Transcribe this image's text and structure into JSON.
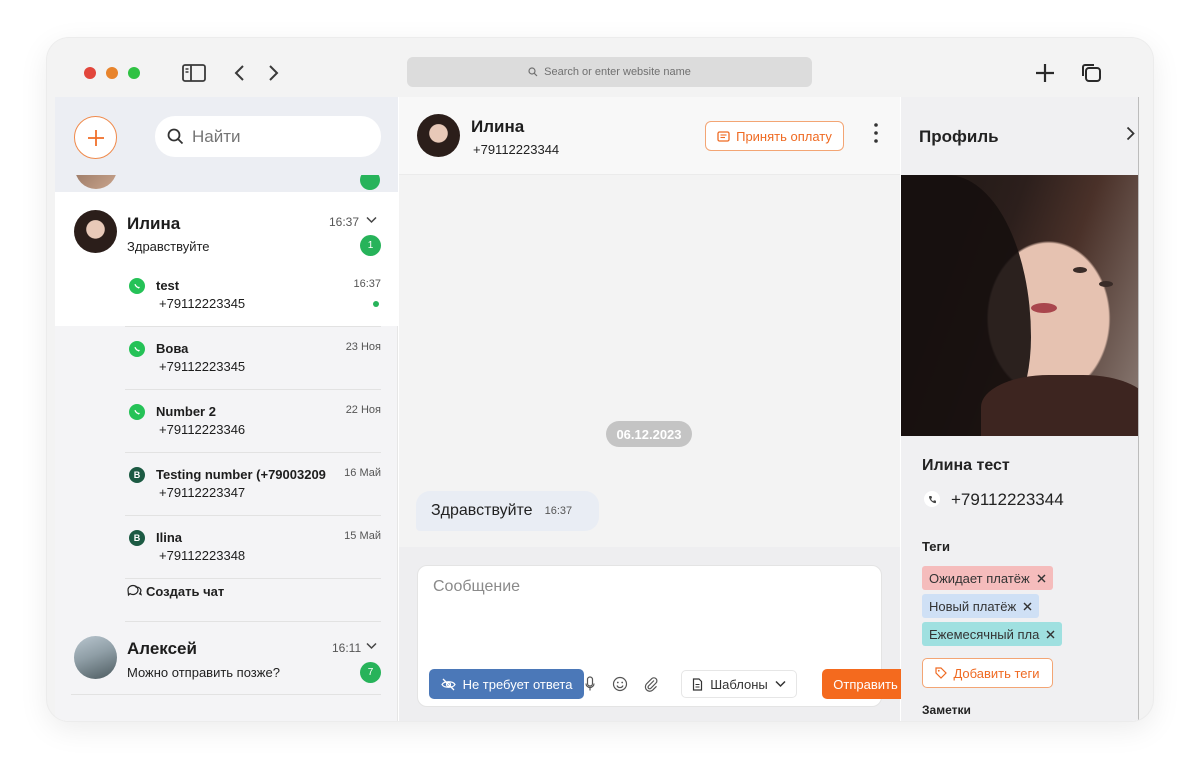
{
  "browser": {
    "address_placeholder": "Search or enter website name"
  },
  "sidebar": {
    "search_placeholder": "Найти",
    "active_conversation": {
      "name": "Илина",
      "last_message": "Здравствуйте",
      "time": "16:37",
      "unread": "1"
    },
    "sub_chats": [
      {
        "channel": "whatsapp",
        "name": "test",
        "phone": "+79112223345",
        "time": "16:37",
        "online": true
      },
      {
        "channel": "whatsapp",
        "name": "Вова",
        "phone": "+79112223345",
        "time": "23 Ноя"
      },
      {
        "channel": "whatsapp",
        "name": "Number 2",
        "phone": "+79112223346",
        "time": "22 Ноя"
      },
      {
        "channel": "viber",
        "name": "Testing number (+79003209",
        "phone": "+79112223347",
        "time": "16 Май"
      },
      {
        "channel": "viber",
        "name": "Ilina",
        "phone": "+79112223348",
        "time": "15 Май"
      }
    ],
    "create_chat_label": "Создать чат",
    "next_conversation": {
      "name": "Алексей",
      "last_message": "Можно отправить позже?",
      "time": "16:11",
      "unread": "7"
    }
  },
  "chat": {
    "contact_name": "Илина",
    "contact_phone": "+79112223344",
    "accept_payment_label": "Принять оплату",
    "date_separator": "06.12.2023",
    "messages": [
      {
        "text": "Здравствуйте",
        "time": "16:37",
        "direction": "incoming"
      }
    ],
    "composer_placeholder": "Сообщение",
    "no_reply_label": "Не требует ответа",
    "templates_label": "Шаблоны",
    "send_label": "Отправить"
  },
  "profile": {
    "title": "Профиль",
    "name": "Илина тест",
    "phone": "+79112223344",
    "tags_label": "Теги",
    "tags": [
      {
        "label": "Ожидает платёж",
        "color": "#f5bcbc"
      },
      {
        "label": "Новый платёж",
        "color": "#cfe0f5"
      },
      {
        "label": "Ежемесячный пла",
        "color": "#9fe0e0"
      }
    ],
    "add_tags_label": "Добавить теги",
    "notes_label": "Заметки"
  },
  "colors": {
    "accent": "#f46a1e",
    "success": "#27b35a",
    "no_reply_button": "#4b78b8"
  }
}
